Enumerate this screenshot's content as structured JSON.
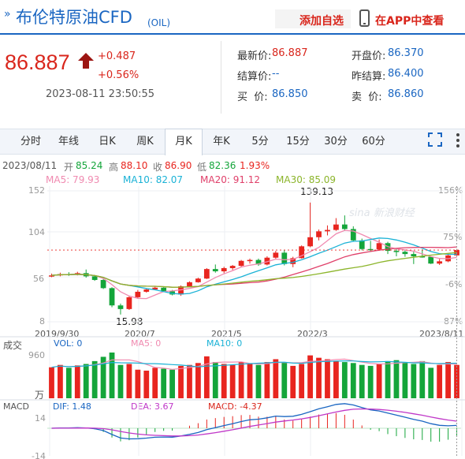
{
  "header": {
    "chevron": "»",
    "title": "布伦特原油CFD",
    "code": "(OIL)",
    "add_favorite": "添加自选",
    "view_in_app": "在APP中查看"
  },
  "quote": {
    "price": "86.887",
    "change": "+0.487",
    "change_pct": "+0.56%",
    "timestamp": "2023-08-11 23:50:55",
    "latest_label": "最新价:",
    "latest_value": "86.887",
    "open_label": "开盘价:",
    "open_value": "86.370",
    "settle_label": "结算价:",
    "settle_value": "--",
    "prev_settle_label": "昨结算:",
    "prev_settle_value": "86.400",
    "buy_label": "买  价:",
    "buy_value": "86.850",
    "sell_label": "卖  价:",
    "sell_value": "86.860"
  },
  "tabs": [
    "分时",
    "年线",
    "日K",
    "周K",
    "月K",
    "年K",
    "5分",
    "15分",
    "30分",
    "60分"
  ],
  "active_tab": "月K",
  "info": {
    "date": "2023/08/11",
    "open_label": "开",
    "open": "85.24",
    "high_label": "高",
    "high": "88.10",
    "close_label": "收",
    "close": "86.90",
    "low_label": "低",
    "low": "82.36",
    "pct": "1.93%"
  },
  "ma": {
    "ma5": "MA5: 79.93",
    "ma10": "MA10: 82.07",
    "ma20": "MA20: 91.12",
    "ma30": "MA30: 85.09"
  },
  "colors": {
    "up": "#e8251f",
    "down": "#14a53a",
    "ma5": "#f08ab0",
    "ma10": "#1ab2d6",
    "ma20": "#e0406a",
    "ma30": "#8cb52b",
    "brand": "#1a66c2"
  },
  "price_axis": [
    "152",
    "104",
    "56",
    "8"
  ],
  "pct_axis": [
    "156%",
    "75%",
    "-6%",
    "-87%"
  ],
  "annotations": {
    "high": "139.13",
    "low": "15.98"
  },
  "date_axis": [
    "2019/9/30",
    "2020/7",
    "2021/5",
    "2022/3",
    "2023/8/11"
  ],
  "volume": {
    "label": "成交",
    "vol": "VOL: 0",
    "ma5": "MA5: 0",
    "ma10": "MA10: 0",
    "top": "960",
    "unit": "万"
  },
  "macd": {
    "label": "MACD",
    "dif": "DIF: 1.48",
    "dea": "DEA: 3.67",
    "macd": "MACD: -4.37",
    "top": "14",
    "bottom": "-14"
  },
  "watermark": "sina 新浪财经",
  "chart_data": {
    "type": "candlestick",
    "x_range": [
      "2019/9/30",
      "2023/8/11"
    ],
    "ylim": [
      8,
      152
    ],
    "candles": [
      [
        58.0,
        59.0,
        61.0,
        57.0
      ],
      [
        59.0,
        60.5,
        62.0,
        58.0
      ],
      [
        60.5,
        60.0,
        62.5,
        58.5
      ],
      [
        60.0,
        61.5,
        63.0,
        59.0
      ],
      [
        61.5,
        58.0,
        65.5,
        56.5
      ],
      [
        58.0,
        54.0,
        59.0,
        53.0
      ],
      [
        54.0,
        45.0,
        55.0,
        44.0
      ],
      [
        45.0,
        26.0,
        46.0,
        24.0
      ],
      [
        26.0,
        22.0,
        28.0,
        15.98
      ],
      [
        22.0,
        35.0,
        36.0,
        21.0
      ],
      [
        35.0,
        41.0,
        43.0,
        34.0
      ],
      [
        41.0,
        43.5,
        44.5,
        40.0
      ],
      [
        43.5,
        45.5,
        46.5,
        43.0
      ],
      [
        45.5,
        41.5,
        46.0,
        40.5
      ],
      [
        41.5,
        38.0,
        43.0,
        37.0
      ],
      [
        38.0,
        47.0,
        48.0,
        36.5
      ],
      [
        47.0,
        51.5,
        52.5,
        46.5
      ],
      [
        51.5,
        55.5,
        56.5,
        51.0
      ],
      [
        55.5,
        66.0,
        67.0,
        55.0
      ],
      [
        66.0,
        63.5,
        71.0,
        62.0
      ],
      [
        63.5,
        67.0,
        68.5,
        61.5
      ],
      [
        67.0,
        69.5,
        70.5,
        65.0
      ],
      [
        69.5,
        75.0,
        76.0,
        68.0
      ],
      [
        75.0,
        76.0,
        77.5,
        72.0
      ],
      [
        76.0,
        71.0,
        77.5,
        69.5
      ],
      [
        71.0,
        78.5,
        80.0,
        70.0
      ],
      [
        78.5,
        84.0,
        86.0,
        77.5
      ],
      [
        84.0,
        71.5,
        86.5,
        70.0
      ],
      [
        71.5,
        78.0,
        79.5,
        68.0
      ],
      [
        78.0,
        91.0,
        92.0,
        77.5
      ],
      [
        91.0,
        101.0,
        139.13,
        90.0
      ],
      [
        101.0,
        107.5,
        109.5,
        97.5
      ],
      [
        107.5,
        109.0,
        114.0,
        103.0
      ],
      [
        109.0,
        115.0,
        122.0,
        108.0
      ],
      [
        115.0,
        110.0,
        125.0,
        108.0
      ],
      [
        110.0,
        97.5,
        113.0,
        96.0
      ],
      [
        97.5,
        88.0,
        99.5,
        86.5
      ],
      [
        88.0,
        87.5,
        97.0,
        85.0
      ],
      [
        87.5,
        94.5,
        98.5,
        86.5
      ],
      [
        94.5,
        86.0,
        96.0,
        82.5
      ],
      [
        86.0,
        85.0,
        89.0,
        80.0
      ],
      [
        85.0,
        82.5,
        87.0,
        79.5
      ],
      [
        82.5,
        80.0,
        85.0,
        71.5
      ],
      [
        80.0,
        79.5,
        87.5,
        78.5
      ],
      [
        79.5,
        72.0,
        80.0,
        71.5
      ],
      [
        72.0,
        74.5,
        77.0,
        70.5
      ],
      [
        74.5,
        81.0,
        82.0,
        73.5
      ],
      [
        81.0,
        86.887,
        88.1,
        82.36
      ]
    ],
    "volume": [
      650,
      700,
      640,
      690,
      720,
      780,
      870,
      960,
      700,
      720,
      600,
      580,
      640,
      620,
      600,
      680,
      700,
      740,
      880,
      760,
      720,
      700,
      760,
      720,
      700,
      760,
      820,
      760,
      680,
      720,
      900,
      850,
      820,
      780,
      760,
      740,
      700,
      680,
      720,
      780,
      800,
      760,
      720,
      780,
      640,
      700,
      760,
      700
    ],
    "ma_series": [
      "MA5",
      "MA10",
      "MA20",
      "MA30"
    ]
  }
}
